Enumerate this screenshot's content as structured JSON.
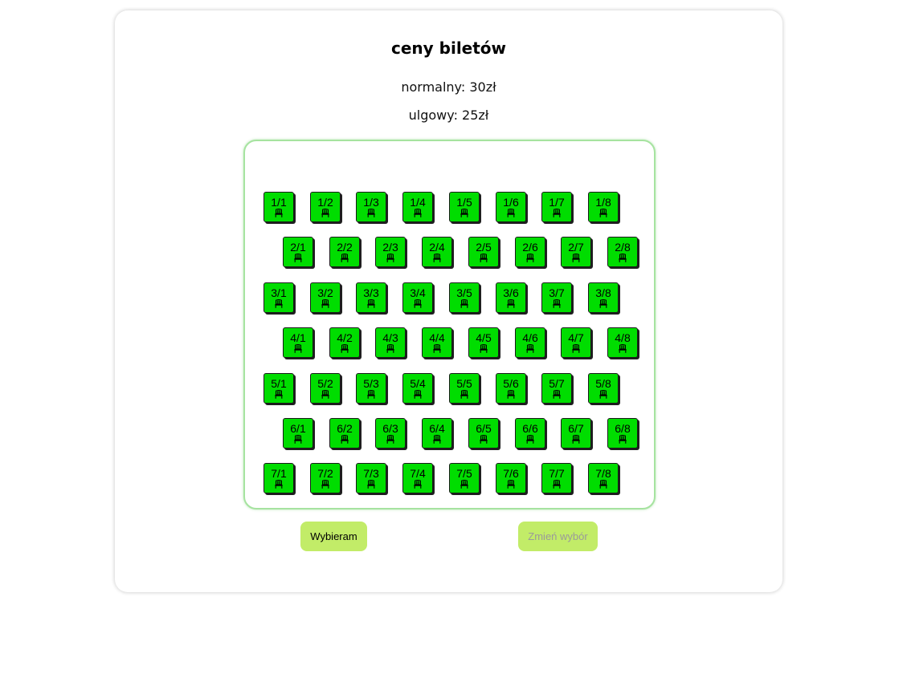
{
  "prices": {
    "title": "ceny biletów",
    "normal": "normalny: 30zł",
    "reduced": "ulgowy: 25zł"
  },
  "hall": {
    "rows": 7,
    "seats_per_row": 8,
    "seat_color": "#00dd00",
    "seat_icon": "chair-icon",
    "seats": [
      [
        "1/1",
        "1/2",
        "1/3",
        "1/4",
        "1/5",
        "1/6",
        "1/7",
        "1/8"
      ],
      [
        "2/1",
        "2/2",
        "2/3",
        "2/4",
        "2/5",
        "2/6",
        "2/7",
        "2/8"
      ],
      [
        "3/1",
        "3/2",
        "3/3",
        "3/4",
        "3/5",
        "3/6",
        "3/7",
        "3/8"
      ],
      [
        "4/1",
        "4/2",
        "4/3",
        "4/4",
        "4/5",
        "4/6",
        "4/7",
        "4/8"
      ],
      [
        "5/1",
        "5/2",
        "5/3",
        "5/4",
        "5/5",
        "5/6",
        "5/7",
        "5/8"
      ],
      [
        "6/1",
        "6/2",
        "6/3",
        "6/4",
        "6/5",
        "6/6",
        "6/7",
        "6/8"
      ],
      [
        "7/1",
        "7/2",
        "7/3",
        "7/4",
        "7/5",
        "7/6",
        "7/7",
        "7/8"
      ]
    ]
  },
  "buttons": {
    "choose_label": "Wybieram",
    "change_label": "Zmień wybór",
    "change_disabled": true,
    "accent": "#c2ec68"
  }
}
